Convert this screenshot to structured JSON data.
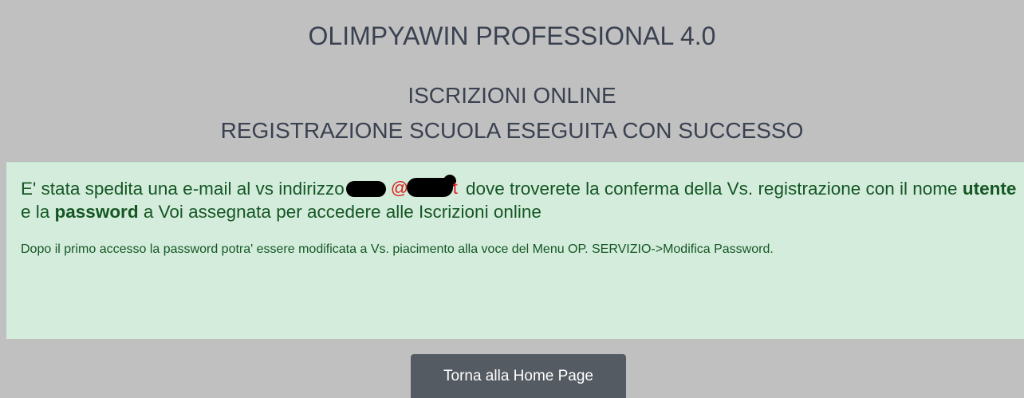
{
  "header": {
    "app_title": "OLIMPYAWIN PROFESSIONAL 4.0",
    "subtitle": "ISCRIZIONI ONLINE",
    "success_message": "REGISTRAZIONE SCUOLA ESEGUITA CON SUCCESSO"
  },
  "alert": {
    "text_before_email": "E' stata spedita una e-mail al vs indirizzo",
    "email_visible_at": "@",
    "email_visible_tail": "t",
    "text_after_email": " dove troverete la conferma della Vs. registrazione con il nome ",
    "bold_user": "utente",
    "text_and": " e la ",
    "bold_password": "password",
    "text_end": " a Voi assegnata per accedere alle Iscrizioni online",
    "note": "Dopo il primo accesso la password potra' essere modificata a Vs. piacimento alla voce del Menu OP. SERVIZIO->Modifica Password.",
    "bg_color": "#d4ecdc",
    "text_color": "#155724"
  },
  "footer": {
    "home_button_label": "Torna alla Home Page"
  },
  "colors": {
    "page_background": "#c0c0c0",
    "header_text": "#3a4150",
    "button_background": "#555b63",
    "email_text": "#e02020"
  }
}
